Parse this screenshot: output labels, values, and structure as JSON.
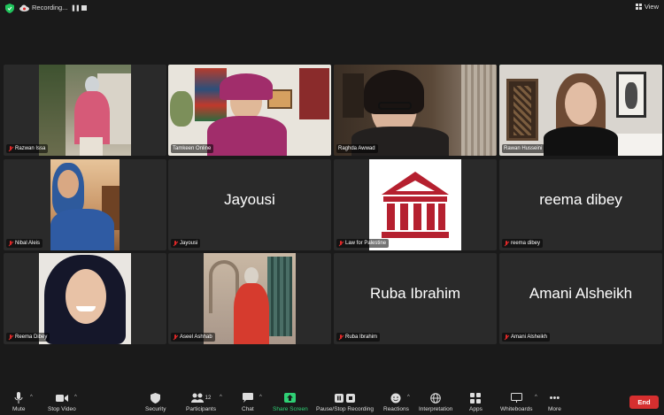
{
  "topbar": {
    "recording_label": "Recording...",
    "view_label": "View"
  },
  "participants": [
    {
      "name": "Razwan Issa",
      "big_name": ""
    },
    {
      "name": "Tamkeen Online",
      "big_name": ""
    },
    {
      "name": "Raghda Awwad",
      "big_name": ""
    },
    {
      "name": "Rawan Husseini",
      "big_name": ""
    },
    {
      "name": "Nibal Aleis",
      "big_name": ""
    },
    {
      "name": "Jayousi",
      "big_name": "Jayousi"
    },
    {
      "name": "Law for Palestine",
      "big_name": ""
    },
    {
      "name": "reema dibey",
      "big_name": "reema dibey"
    },
    {
      "name": "Reema Dibey",
      "big_name": ""
    },
    {
      "name": "Aseel Ashhab",
      "big_name": ""
    },
    {
      "name": "Ruba Ibrahim",
      "big_name": "Ruba Ibrahim"
    },
    {
      "name": "Amani Alsheikh",
      "big_name": "Amani Alsheikh"
    }
  ],
  "toolbar": {
    "mute": "Mute",
    "stop_video": "Stop Video",
    "security": "Security",
    "participants": "Participants",
    "participants_count": "12",
    "chat": "Chat",
    "share_screen": "Share Screen",
    "pause_stop_recording": "Pause/Stop Recording",
    "reactions": "Reactions",
    "interpretation": "Interpretation",
    "apps": "Apps",
    "whiteboards": "Whiteboards",
    "more": "More",
    "end": "End"
  },
  "colors": {
    "active_speaker": "#21c55d",
    "end_button": "#d62f2f",
    "muted_mic": "#e02828",
    "law_logo": "#b5202f"
  }
}
